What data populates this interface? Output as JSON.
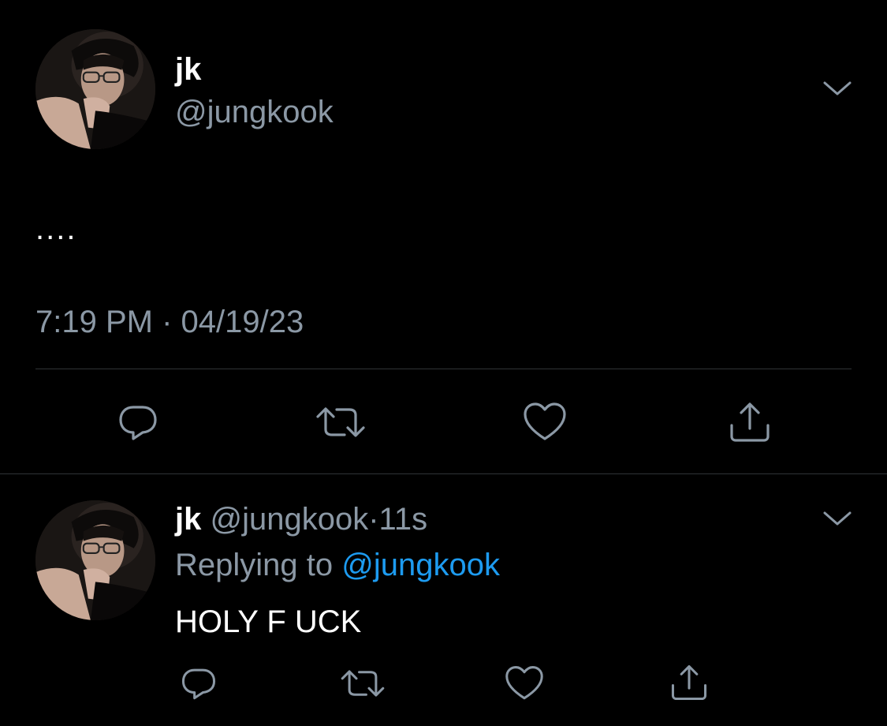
{
  "colors": {
    "background": "#000000",
    "primary_text": "#ffffff",
    "secondary_text": "#8b98a5",
    "link": "#1d9bf0",
    "divider": "#2f3336",
    "icon": "#8b98a5"
  },
  "main_tweet": {
    "display_name": "jk",
    "handle": "@jungkook",
    "text": "....",
    "timestamp": "7:19 PM · 04/19/23",
    "avatar_icon": "profile-photo",
    "menu_icon": "chevron-down-icon",
    "actions": [
      {
        "name": "reply",
        "icon": "reply-icon"
      },
      {
        "name": "retweet",
        "icon": "retweet-icon"
      },
      {
        "name": "like",
        "icon": "heart-icon"
      },
      {
        "name": "share",
        "icon": "share-icon"
      }
    ]
  },
  "reply_tweet": {
    "display_name": "jk",
    "handle": "@jungkook",
    "separator": "·",
    "time_ago": "11s",
    "replying_prefix": "Replying to",
    "replying_to": "@jungkook",
    "text": "HOLY F UCK",
    "avatar_icon": "profile-photo",
    "menu_icon": "chevron-down-icon",
    "actions": [
      {
        "name": "reply",
        "icon": "reply-icon"
      },
      {
        "name": "retweet",
        "icon": "retweet-icon"
      },
      {
        "name": "like",
        "icon": "heart-icon"
      },
      {
        "name": "share",
        "icon": "share-icon"
      }
    ]
  }
}
